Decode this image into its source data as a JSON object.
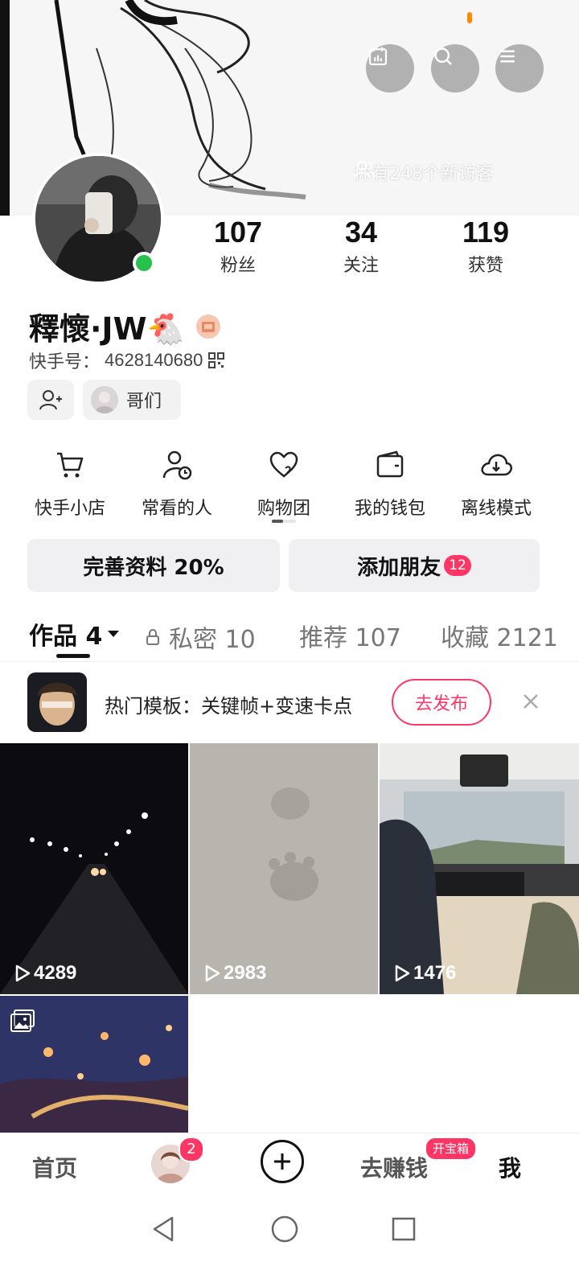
{
  "header": {
    "visitors_text": "你有248个新访客",
    "icons": [
      "calendar-icon",
      "search-icon",
      "menu-icon"
    ]
  },
  "profile": {
    "stats": [
      {
        "value": "107",
        "label": "粉丝"
      },
      {
        "value": "34",
        "label": "关注"
      },
      {
        "value": "119",
        "label": "获赞"
      }
    ],
    "nickname": "釋懷·JW🐔",
    "kuaishou_id_label": "快手号：",
    "kuaishou_id": "4628140680",
    "chip_label": "哥们"
  },
  "shortcuts": [
    {
      "label": "快手小店",
      "icon": "cart-icon"
    },
    {
      "label": "常看的人",
      "icon": "user-clock-icon"
    },
    {
      "label": "购物团",
      "icon": "heart-icon"
    },
    {
      "label": "我的钱包",
      "icon": "wallet-icon"
    },
    {
      "label": "离线模式",
      "icon": "cloud-download-icon"
    }
  ],
  "actions": {
    "complete_profile": "完善资料 20%",
    "add_friends": "添加朋友",
    "add_friends_badge": "12"
  },
  "tabs": [
    {
      "label": "作品 4"
    },
    {
      "label": "私密 10"
    },
    {
      "label": "推荐 107"
    },
    {
      "label": "收藏 2121"
    }
  ],
  "template_bar": {
    "text": "热门模板：关键帧+变速卡点",
    "button": "去发布"
  },
  "videos": [
    {
      "plays": "4289"
    },
    {
      "plays": "2983"
    },
    {
      "plays": "1476"
    }
  ],
  "bottom_nav": {
    "home": "首页",
    "friends_badge": "2",
    "earn": "去赚钱",
    "earn_badge": "开宝箱",
    "me": "我"
  },
  "colors": {
    "accent": "#fe3666",
    "online": "#27c24c"
  }
}
